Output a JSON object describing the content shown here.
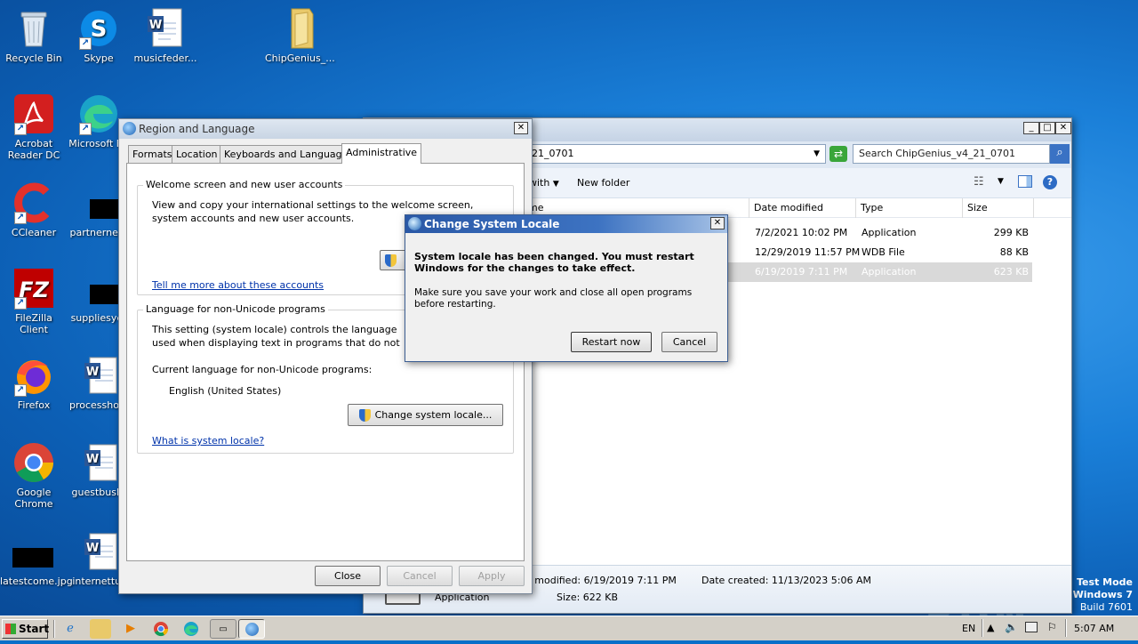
{
  "desktop_icons": [
    {
      "label": "Recycle Bin",
      "icon": "recycle-bin-icon"
    },
    {
      "label": "Skype",
      "icon": "skype-icon"
    },
    {
      "label": "musicfeder...",
      "icon": "word-document-icon"
    },
    {
      "label": "ChipGenius_...",
      "icon": "folder-icon"
    },
    {
      "label": "Acrobat Reader DC",
      "icon": "acrobat-icon"
    },
    {
      "label": "Microsoft Ed",
      "icon": "edge-icon"
    },
    {
      "label": "CCleaner",
      "icon": "ccleaner-icon"
    },
    {
      "label": "partnernext",
      "icon": "black-file-icon"
    },
    {
      "label": "FileZilla Client",
      "icon": "filezilla-icon"
    },
    {
      "label": "suppliesyet",
      "icon": "black-file-icon"
    },
    {
      "label": "Firefox",
      "icon": "firefox-icon"
    },
    {
      "label": "processhold",
      "icon": "word-document-icon"
    },
    {
      "label": "Google Chrome",
      "icon": "chrome-icon"
    },
    {
      "label": "guestbush.",
      "icon": "word-document-icon"
    },
    {
      "label": "latestcome.jpg",
      "icon": "black-file-icon"
    },
    {
      "label": "internettur",
      "icon": "word-document-icon"
    }
  ],
  "explorer": {
    "address": "21_0701",
    "search_placeholder": "Search ChipGenius_v4_21_0701",
    "toolbar": {
      "open_with": "with",
      "new_folder": "New folder"
    },
    "columns": [
      "me",
      "Date modified",
      "Type",
      "Size"
    ],
    "rows": [
      {
        "date": "7/2/2021 10:02 PM",
        "type": "Application",
        "size": "299 KB"
      },
      {
        "date": "12/29/2019 11:57 PM",
        "type": "WDB File",
        "size": "88 KB"
      },
      {
        "date": "6/19/2019 7:11 PM",
        "type": "Application",
        "size": "623 KB"
      }
    ],
    "details": {
      "modified": "e modified: 6/19/2019 7:11 PM",
      "created": "Date created: 11/13/2023 5:06 AM",
      "type": "Application",
      "size": "Size: 622 KB"
    }
  },
  "region_dialog": {
    "title": "Region and Language",
    "tabs": [
      "Formats",
      "Location",
      "Keyboards and Languages",
      "Administrative"
    ],
    "welcome_group": {
      "legend": "Welcome screen and new user accounts",
      "text": "View and copy your international settings to the welcome screen, system accounts and new user accounts.",
      "link": "Tell me more about these accounts"
    },
    "unicode_group": {
      "legend": "Language for non-Unicode programs",
      "text": "This setting (system locale) controls the language used when displaying text in programs that do not support Unicode.",
      "current_label": "Current language for non-Unicode programs:",
      "current_value": "English (United States)",
      "change_button": "Change system locale...",
      "link": "What is system locale?"
    },
    "buttons": {
      "close": "Close",
      "cancel": "Cancel",
      "apply": "Apply"
    }
  },
  "locale_dialog": {
    "title": "Change System Locale",
    "message_bold": "System locale has been changed. You must restart Windows for the changes to take effect.",
    "message": "Make sure you save your work and close all open programs before restarting.",
    "restart_button": "Restart now",
    "cancel_button": "Cancel"
  },
  "watermark": {
    "line1": "Test Mode",
    "line2": "Windows 7",
    "line3": "Build 7601",
    "brand": "ANY RUN"
  },
  "taskbar": {
    "start_label": "Start",
    "language": "EN",
    "time": "5:07 AM",
    "pinned": [
      "ie-icon",
      "explorer-icon",
      "media-player-icon",
      "chrome-icon",
      "edge-icon",
      "keyboard-icon",
      "region-icon"
    ]
  },
  "colors": {
    "titlebar_active": "#2d5ba8",
    "titlebar_inactive": "#c9d5e4",
    "selection": "#d7d7d7",
    "link": "#0033aa"
  }
}
